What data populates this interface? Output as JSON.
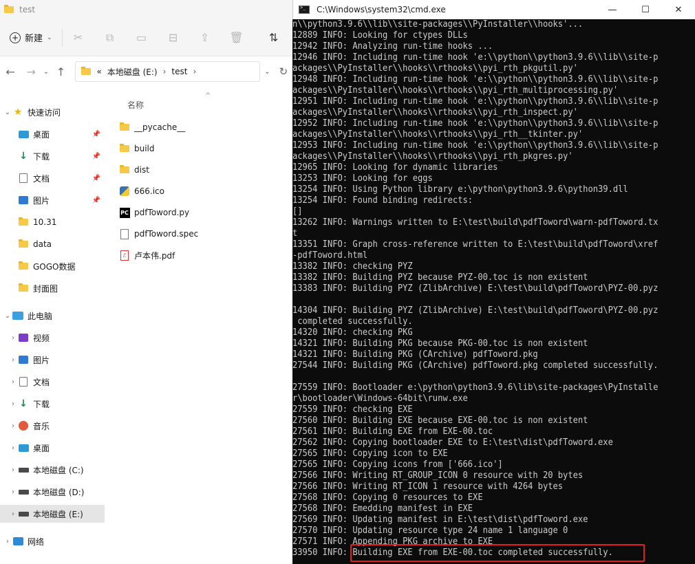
{
  "explorer": {
    "title": "test",
    "toolbar": {
      "new_label": "新建"
    },
    "address": {
      "chevrons": "«",
      "drive": "本地磁盘 (E:)",
      "folder": "test"
    },
    "column_header": "名称",
    "nav": [
      {
        "label": "快速访问",
        "icon": "star-icon",
        "expand": "⌄",
        "pinned": false
      },
      {
        "label": "桌面",
        "icon": "desktop-icon",
        "pinned": true
      },
      {
        "label": "下载",
        "icon": "download-icon",
        "pinned": true
      },
      {
        "label": "文档",
        "icon": "document-icon",
        "pinned": true
      },
      {
        "label": "图片",
        "icon": "pictures-icon",
        "pinned": true
      },
      {
        "label": "10.31",
        "icon": "folder-icon",
        "pinned": false
      },
      {
        "label": "data",
        "icon": "folder-icon",
        "pinned": false
      },
      {
        "label": "GOGO数据",
        "icon": "folder-icon",
        "pinned": false
      },
      {
        "label": "封面图",
        "icon": "folder-icon",
        "pinned": false
      },
      {
        "label": "此电脑",
        "icon": "computer-icon",
        "expand": "⌄",
        "pinned": false
      },
      {
        "label": "视频",
        "icon": "video-icon",
        "expand": "›",
        "pinned": false
      },
      {
        "label": "图片",
        "icon": "pictures-icon",
        "expand": "›",
        "pinned": false
      },
      {
        "label": "文档",
        "icon": "document-icon",
        "expand": "›",
        "pinned": false
      },
      {
        "label": "下载",
        "icon": "download-icon",
        "expand": "›",
        "pinned": false
      },
      {
        "label": "音乐",
        "icon": "music-icon",
        "expand": "›",
        "pinned": false
      },
      {
        "label": "桌面",
        "icon": "desktop-icon",
        "expand": "›",
        "pinned": false
      },
      {
        "label": "本地磁盘 (C:)",
        "icon": "drive-icon",
        "expand": "›",
        "pinned": false
      },
      {
        "label": "本地磁盘 (D:)",
        "icon": "drive-icon",
        "expand": "›",
        "pinned": false
      },
      {
        "label": "本地磁盘 (E:)",
        "icon": "drive-icon",
        "expand": "›",
        "pinned": false,
        "selected": true
      },
      {
        "label": "网络",
        "icon": "network-icon",
        "expand": "›",
        "pinned": false
      }
    ],
    "files": [
      {
        "name": "__pycache__",
        "icon": "folder-icon"
      },
      {
        "name": "build",
        "icon": "folder-icon"
      },
      {
        "name": "dist",
        "icon": "folder-icon"
      },
      {
        "name": "666.ico",
        "icon": "python-icon"
      },
      {
        "name": "pdfToword.py",
        "icon": "pycharm-icon"
      },
      {
        "name": "pdfToword.spec",
        "icon": "file-icon"
      },
      {
        "name": "卢本伟.pdf",
        "icon": "pdf-icon"
      }
    ]
  },
  "cmd": {
    "title": "C:\\Windows\\system32\\cmd.exe",
    "highlight_color": "#e02020",
    "lines": [
      "n\\\\python3.9.6\\\\lib\\\\site-packages\\\\PyInstaller\\\\hooks'...",
      "12889 INFO: Looking for ctypes DLLs",
      "12942 INFO: Analyzing run-time hooks ...",
      "12946 INFO: Including run-time hook 'e:\\\\python\\\\python3.9.6\\\\lib\\\\site-p",
      "ackages\\\\PyInstaller\\\\hooks\\\\rthooks\\\\pyi_rth_pkgutil.py'",
      "12948 INFO: Including run-time hook 'e:\\\\python\\\\python3.9.6\\\\lib\\\\site-p",
      "ackages\\\\PyInstaller\\\\hooks\\\\rthooks\\\\pyi_rth_multiprocessing.py'",
      "12951 INFO: Including run-time hook 'e:\\\\python\\\\python3.9.6\\\\lib\\\\site-p",
      "ackages\\\\PyInstaller\\\\hooks\\\\rthooks\\\\pyi_rth_inspect.py'",
      "12952 INFO: Including run-time hook 'e:\\\\python\\\\python3.9.6\\\\lib\\\\site-p",
      "ackages\\\\PyInstaller\\\\hooks\\\\rthooks\\\\pyi_rth__tkinter.py'",
      "12953 INFO: Including run-time hook 'e:\\\\python\\\\python3.9.6\\\\lib\\\\site-p",
      "ackages\\\\PyInstaller\\\\hooks\\\\rthooks\\\\pyi_rth_pkgres.py'",
      "12965 INFO: Looking for dynamic libraries",
      "13253 INFO: Looking for eggs",
      "13254 INFO: Using Python library e:\\python\\python3.9.6\\python39.dll",
      "13254 INFO: Found binding redirects:",
      "[]",
      "13262 INFO: Warnings written to E:\\test\\build\\pdfToword\\warn-pdfToword.tx",
      "t",
      "13351 INFO: Graph cross-reference written to E:\\test\\build\\pdfToword\\xref",
      "-pdfToword.html",
      "13382 INFO: checking PYZ",
      "13382 INFO: Building PYZ because PYZ-00.toc is non existent",
      "13383 INFO: Building PYZ (ZlibArchive) E:\\test\\build\\pdfToword\\PYZ-00.pyz",
      "",
      "14304 INFO: Building PYZ (ZlibArchive) E:\\test\\build\\pdfToword\\PYZ-00.pyz",
      " completed successfully.",
      "14320 INFO: checking PKG",
      "14321 INFO: Building PKG because PKG-00.toc is non existent",
      "14321 INFO: Building PKG (CArchive) pdfToword.pkg",
      "27544 INFO: Building PKG (CArchive) pdfToword.pkg completed successfully.",
      "",
      "27559 INFO: Bootloader e:\\python\\python3.9.6\\lib\\site-packages\\PyInstalle",
      "r\\bootloader\\Windows-64bit\\runw.exe",
      "27559 INFO: checking EXE",
      "27560 INFO: Building EXE because EXE-00.toc is non existent",
      "27561 INFO: Building EXE from EXE-00.toc",
      "27562 INFO: Copying bootloader EXE to E:\\test\\dist\\pdfToword.exe",
      "27565 INFO: Copying icon to EXE",
      "27565 INFO: Copying icons from ['666.ico']",
      "27566 INFO: Writing RT_GROUP_ICON 0 resource with 20 bytes",
      "27566 INFO: Writing RT_ICON 1 resource with 4264 bytes",
      "27568 INFO: Copying 0 resources to EXE",
      "27568 INFO: Emedding manifest in EXE",
      "27569 INFO: Updating manifest in E:\\test\\dist\\pdfToword.exe",
      "27570 INFO: Updating resource type 24 name 1 language 0",
      "27571 INFO: Appending PKG archive to EXE",
      "33950 INFO: Building EXE from EXE-00.toc completed successfully."
    ]
  }
}
